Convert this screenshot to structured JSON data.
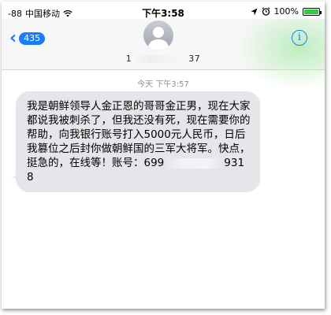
{
  "status_bar": {
    "signal": "-88",
    "carrier": "中国移动",
    "time": "下午3:58",
    "battery": "100%",
    "battery_level": 1.0
  },
  "header": {
    "back_label": "435",
    "contact_number_start": "1",
    "contact_number_end": "37",
    "info_glyph": "i"
  },
  "conversation": {
    "timestamp": "今天 下午3:57",
    "message_text": "我是朝鲜领导人金正恩的哥哥金正男，现在大家都说我被刺杀了，但我还没有死，现在需要你的帮助，向我银行账号打入5000元人民币，日后我篡位之后封你做朝鲜国的三军大将军。快点，挺急的，在线等！账号：699",
    "message_text_end": "9318"
  },
  "icons": [
    "wifi-icon",
    "location-arrow-icon",
    "alarm-clock-icon",
    "battery-icon",
    "back-chevron-icon",
    "avatar-person-icon",
    "info-icon"
  ]
}
